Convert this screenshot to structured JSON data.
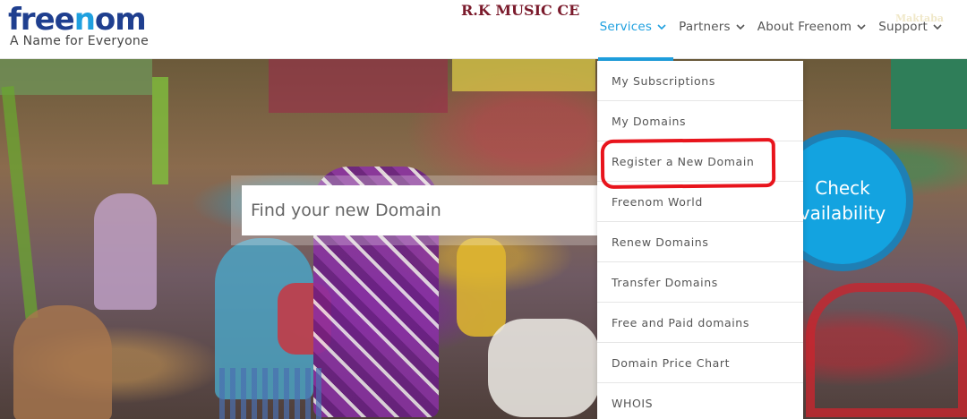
{
  "header": {
    "logo_parts": [
      "fr",
      "ee",
      "n",
      "om"
    ],
    "tagline": "A Name for Everyone",
    "nav": [
      {
        "label": "Services",
        "active": true
      },
      {
        "label": "Partners",
        "active": false
      },
      {
        "label": "About Freenom",
        "active": false
      },
      {
        "label": "Support",
        "active": false
      }
    ],
    "accent_color": "#1fa0df"
  },
  "hero": {
    "sign_text": "R.K MUSIC CE",
    "sign_right_text": "Maktaba"
  },
  "search": {
    "placeholder": "Find your new Domain",
    "check_line1": "Check",
    "check_line2": "vailability"
  },
  "services_menu": {
    "items": [
      "My Subscriptions",
      "My Domains",
      "Register a New Domain",
      "Freenom World",
      "Renew Domains",
      "Transfer Domains",
      "Free and Paid domains",
      "Domain Price Chart",
      "WHOIS"
    ],
    "highlighted_item": "Register a New Domain",
    "highlight_color": "#e8141c"
  }
}
